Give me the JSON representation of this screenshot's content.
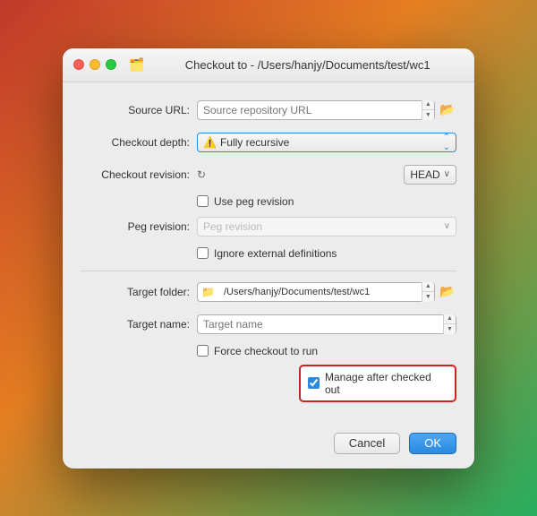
{
  "window": {
    "title": "Checkout to - /Users/hanjy/Documents/test/wc1",
    "icon": "🗂️"
  },
  "trafficLights": {
    "close": "close",
    "minimize": "minimize",
    "maximize": "maximize"
  },
  "form": {
    "sourceUrl": {
      "label": "Source URL:",
      "placeholder": "Source repository URL"
    },
    "checkoutDepth": {
      "label": "Checkout depth:",
      "icon": "⚠️",
      "value": "Fully recursive"
    },
    "checkoutRevision": {
      "label": "Checkout revision:",
      "icon": "↻",
      "headValue": "HEAD"
    },
    "usePegRevision": {
      "label": "Use peg revision",
      "checked": false
    },
    "pegRevision": {
      "label": "Peg revision:",
      "placeholder": "Peg revision"
    },
    "ignoreExternalDefinitions": {
      "label": "Ignore external definitions",
      "checked": false
    },
    "targetFolder": {
      "label": "Target folder:",
      "icon": "📁",
      "value": "/Users/hanjy/Documents/test/wc1"
    },
    "targetName": {
      "label": "Target name:",
      "placeholder": "Target name"
    },
    "forceCheckout": {
      "label": "Force checkout to run",
      "checked": false
    },
    "manageAfterCheckedOut": {
      "label": "Manage after checked out",
      "checked": true
    }
  },
  "buttons": {
    "cancel": "Cancel",
    "ok": "OK"
  },
  "colors": {
    "accent": "#2a8ae0",
    "highlight_border": "#cc2222"
  }
}
